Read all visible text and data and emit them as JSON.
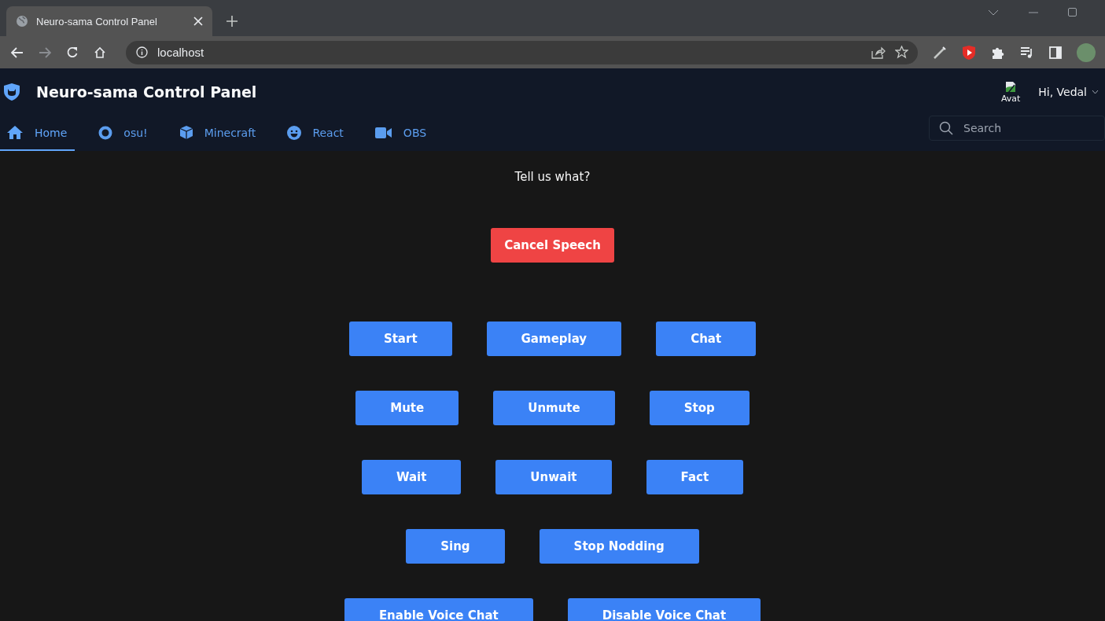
{
  "browser": {
    "tab_title": "Neuro-sama Control Panel",
    "address": "localhost"
  },
  "header": {
    "title": "Neuro-sama Control Panel",
    "avatar_alt": "Avat",
    "greeting": "Hi, Vedal"
  },
  "tabs": [
    {
      "label": "Home",
      "selected": true
    },
    {
      "label": "osu!",
      "selected": false
    },
    {
      "label": "Minecraft",
      "selected": false
    },
    {
      "label": "React",
      "selected": false
    },
    {
      "label": "OBS",
      "selected": false
    }
  ],
  "search": {
    "placeholder": "Search"
  },
  "prompt": "Tell us what?",
  "cancel_button": "Cancel Speech",
  "button_rows": [
    [
      "Start",
      "Gameplay",
      "Chat"
    ],
    [
      "Mute",
      "Unmute",
      "Stop"
    ],
    [
      "Wait",
      "Unwait",
      "Fact"
    ],
    [
      "Sing",
      "Stop Nodding"
    ],
    [
      "Enable Voice Chat",
      "Disable Voice Chat"
    ]
  ]
}
